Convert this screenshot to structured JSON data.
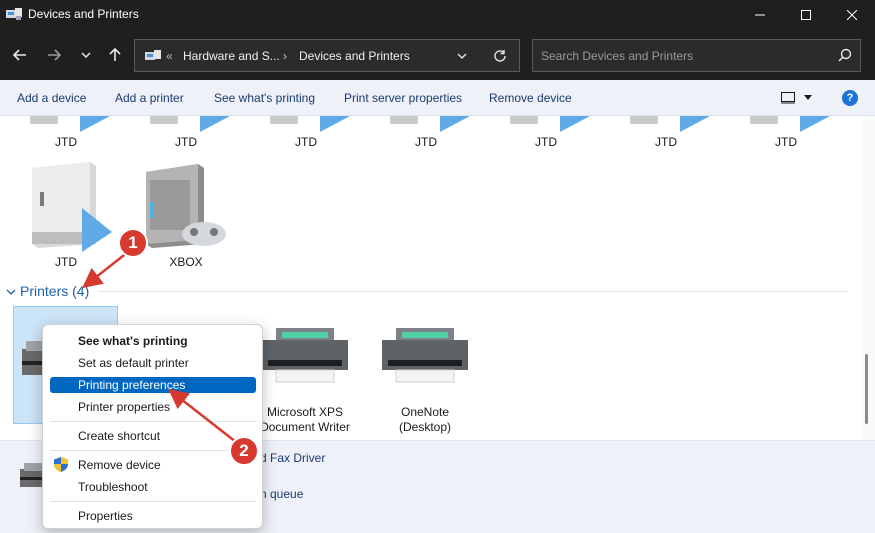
{
  "window": {
    "title": "Devices and Printers"
  },
  "address": {
    "segments": [
      "Hardware and S...",
      "Devices and Printers"
    ],
    "overflow": "«"
  },
  "search": {
    "placeholder": "Search Devices and Printers"
  },
  "commands": [
    "Add a device",
    "Add a printer",
    "See what's printing",
    "Print server properties",
    "Remove device"
  ],
  "devices_top_row": [
    "JTD",
    "JTD",
    "JTD",
    "JTD",
    "JTD",
    "JTD",
    "JTD"
  ],
  "devices": [
    {
      "label": "JTD",
      "icon": "computer-icon"
    },
    {
      "label": "XBOX",
      "icon": "xbox-console-icon"
    }
  ],
  "printers_group": {
    "label": "Printers",
    "count": "(4)"
  },
  "printers": [
    {
      "line1": "Microsoft XPS",
      "line2": "Document Writer",
      "icon": "printer-icon"
    },
    {
      "line1": "OneNote",
      "line2": "(Desktop)",
      "icon": "printer-icon"
    }
  ],
  "details": {
    "line1": "d Fax Driver",
    "line2": "n queue"
  },
  "context_menu": {
    "see_whats_printing": "See what's printing",
    "set_default": "Set as default printer",
    "printing_preferences": "Printing preferences",
    "printer_properties": "Printer properties",
    "create_shortcut": "Create shortcut",
    "remove_device": "Remove device",
    "troubleshoot": "Troubleshoot",
    "properties": "Properties"
  },
  "annotations": {
    "badge1": "1",
    "badge2": "2"
  },
  "colors": {
    "accent": "#0067c0",
    "annotation": "#d63a2f",
    "link": "#1f5fa8"
  }
}
